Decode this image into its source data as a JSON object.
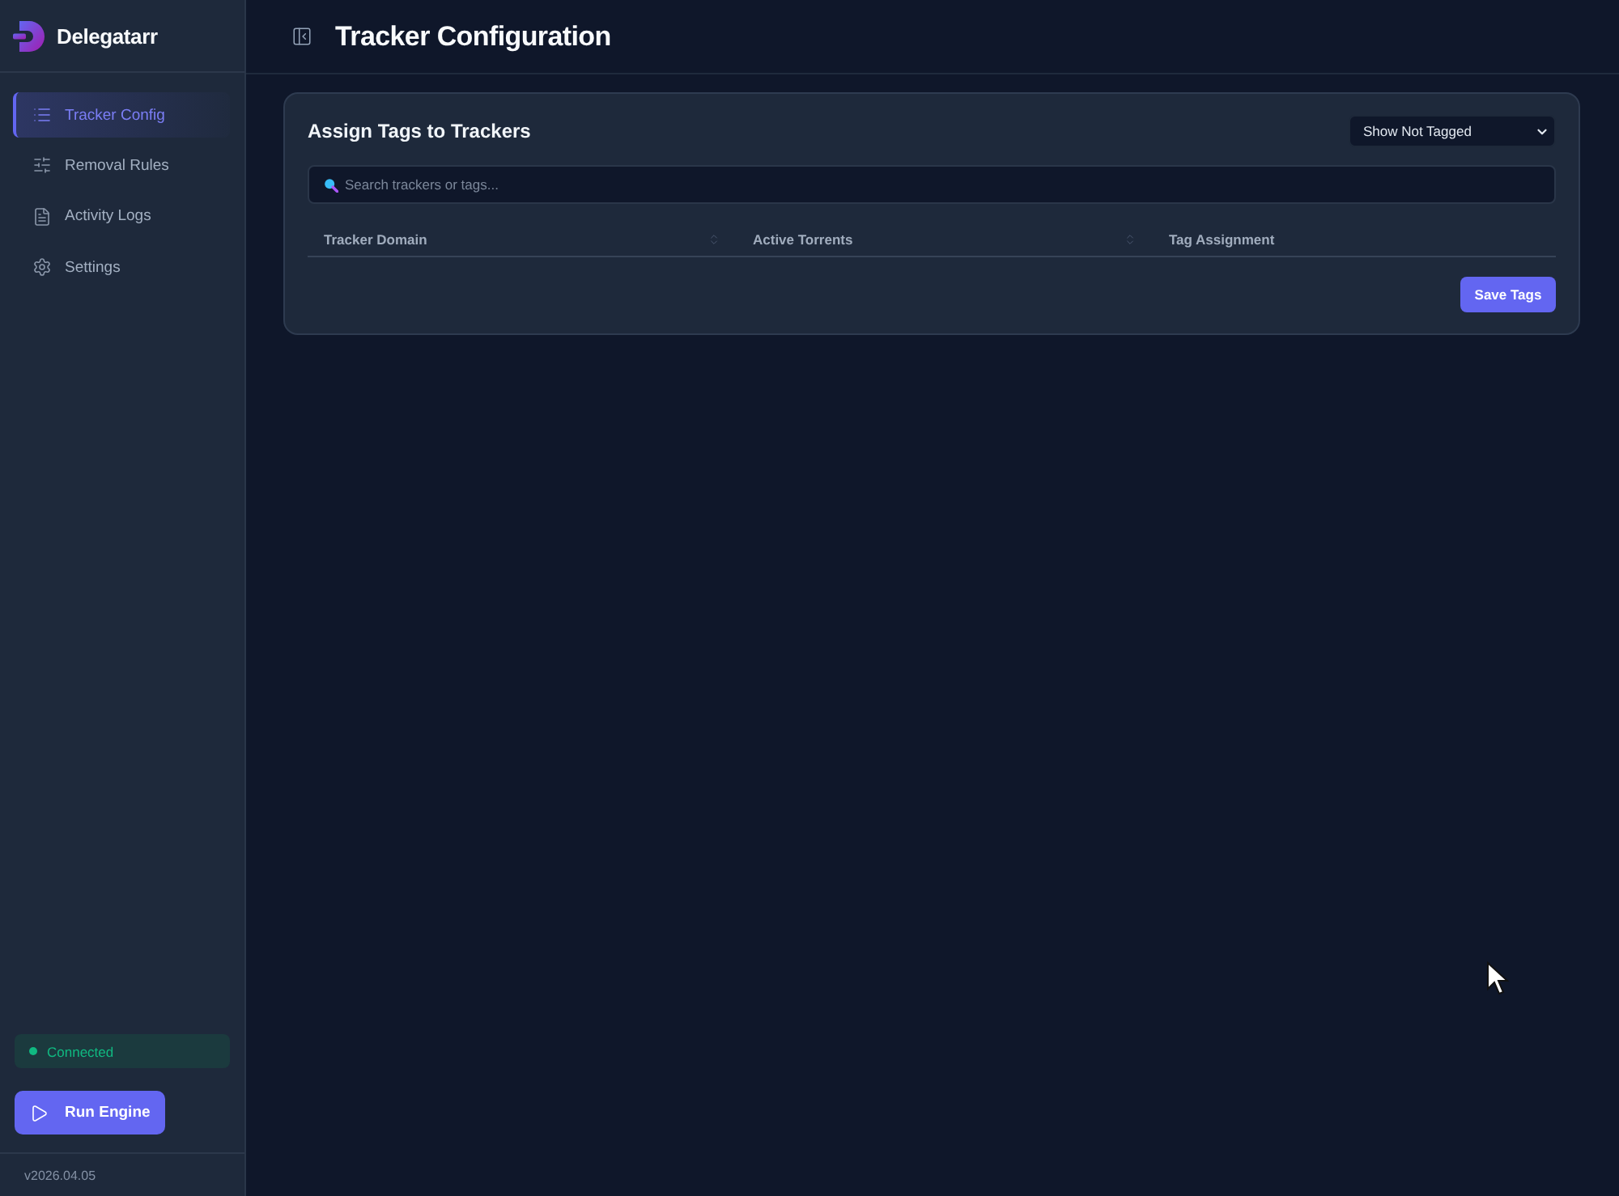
{
  "app": {
    "name": "Delegatarr"
  },
  "sidebar": {
    "items": [
      {
        "label": "Tracker Config",
        "selected": true
      },
      {
        "label": "Removal Rules",
        "selected": false
      },
      {
        "label": "Activity Logs",
        "selected": false
      },
      {
        "label": "Settings",
        "selected": false
      }
    ]
  },
  "status": {
    "label": "Connected",
    "connected": true
  },
  "run_button": {
    "label": "Run Engine"
  },
  "version": "v2026.04.05",
  "header": {
    "title": "Tracker Configuration"
  },
  "card": {
    "title": "Assign Tags to Trackers",
    "filter": {
      "value": "Show Not Tagged"
    },
    "search": {
      "placeholder": "Search trackers or tags..."
    },
    "table": {
      "columns": [
        {
          "label": "Tracker Domain",
          "sortable": true
        },
        {
          "label": "Active Torrents",
          "sortable": true
        },
        {
          "label": "Tag Assignment",
          "sortable": false
        }
      ]
    },
    "save_button": {
      "label": "Save Tags"
    }
  }
}
